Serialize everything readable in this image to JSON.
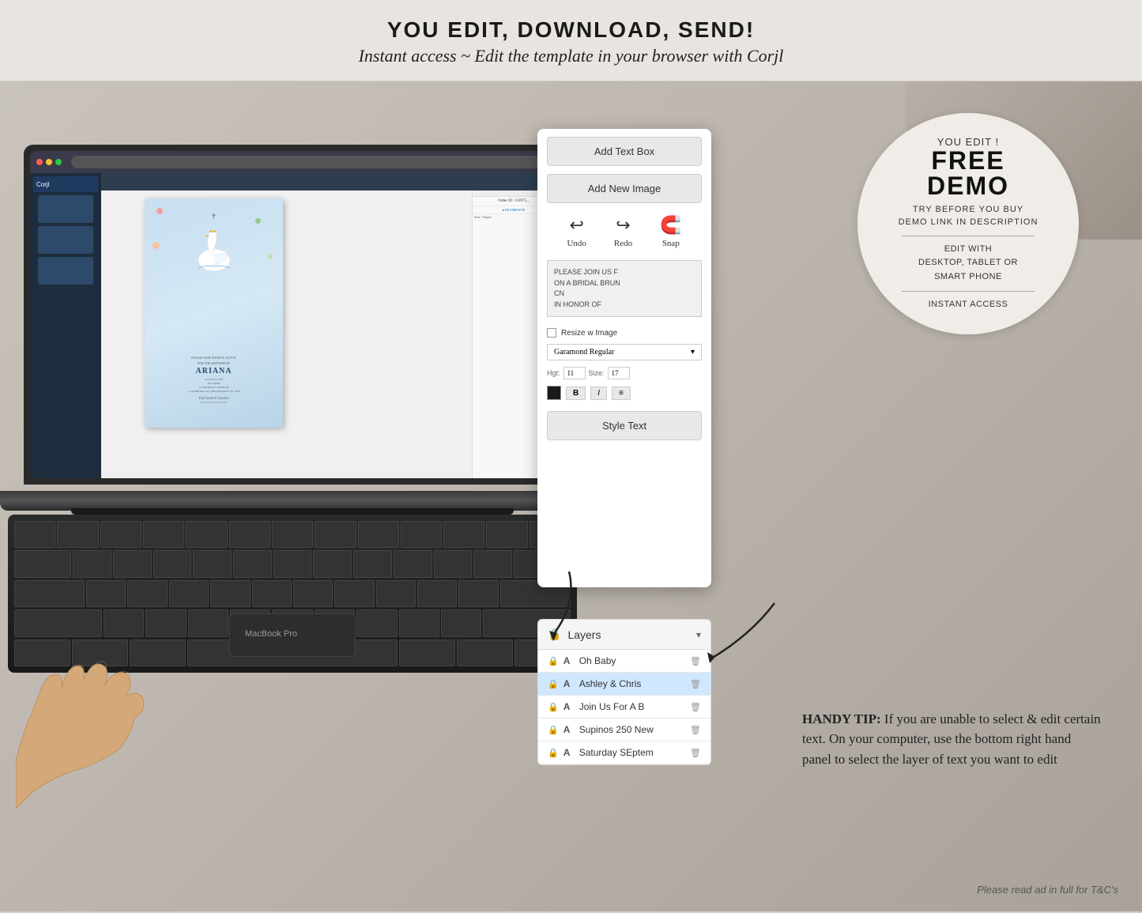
{
  "header": {
    "headline": "YOU EDIT, DOWNLOAD, SEND!",
    "subheadline": "Instant access ~ Edit the template in your browser with Corjl"
  },
  "demo_circle": {
    "you_edit": "YOU EDIT !",
    "free": "FREE",
    "demo": "DEMO",
    "try_before": "TRY BEFORE YOU BUY",
    "demo_link": "DEMO LINK IN DESCRIPTION",
    "edit_with": "EDIT WITH",
    "devices": "DESKTOP, TABLET OR",
    "smart_phone": "SMART PHONE",
    "instant": "INSTANT ACCESS"
  },
  "panel": {
    "add_text_box": "Add Text Box",
    "add_new_image": "Add New Image",
    "undo": "Undo",
    "redo": "Redo",
    "snap": "Snap",
    "resize_image": "Resize w Image",
    "style_text": "Style Text",
    "preview_text": "PLEASE JOIN US F\nON A BRIDAL BRUN\nCN\nIN HONOR OF"
  },
  "layers": {
    "title": "Layers",
    "items": [
      {
        "name": "Oh Baby",
        "highlighted": false
      },
      {
        "name": "Ashley & Chris",
        "highlighted": true
      },
      {
        "name": "Join Us For A B",
        "highlighted": false
      },
      {
        "name": "Supinos 250 New",
        "highlighted": false
      },
      {
        "name": "Saturday SEptem",
        "highlighted": false
      }
    ]
  },
  "invitation": {
    "please_join": "PLEASE JOIN DAVID & OLIVIA",
    "for_the": "FOR THE BAPTISM OF",
    "name": "ARIANA",
    "date": "AUGUST 15TH",
    "time": "AT 2:00PM",
    "venue": "ST PATRICK'S CHURCH",
    "address": "1 CATHEDRAL PL, MELBOURNE VIC 3000",
    "rsvp": "RSVP OLIVIA",
    "enchanted_garden": "Enchanted Garden"
  },
  "handy_tip": {
    "label": "HANDY TIP:",
    "text": "If you are unable to select & edit certain text. On your computer, use the bottom right hand panel to select the layer of text you want to edit"
  },
  "footer": {
    "text": "Please read ad in full for T&C's"
  },
  "arrow_texts": {
    "curved_arrow_label": "curved arrow decoration"
  }
}
